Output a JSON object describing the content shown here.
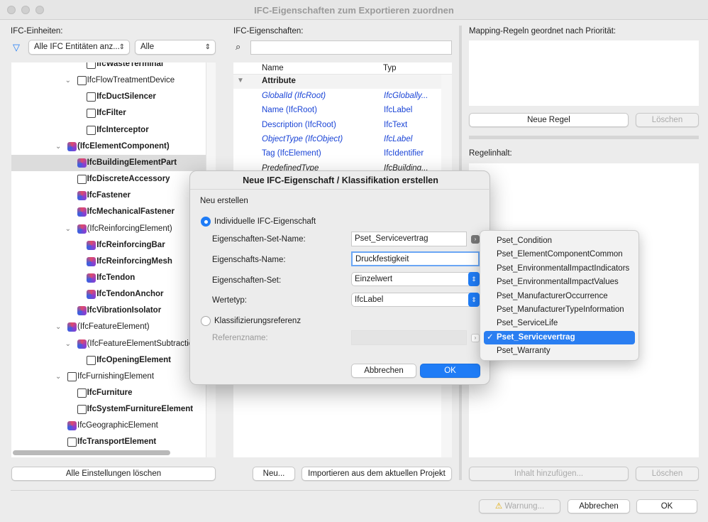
{
  "window": {
    "title": "IFC-Eigenschaften zum Exportieren zuordnen"
  },
  "left": {
    "label": "IFC-Einheiten:",
    "filter1": "Alle IFC Entitäten anz...",
    "filter2": "Alle",
    "clear_button": "Alle Einstellungen löschen",
    "tree": [
      {
        "label": "IfcWasteTerminal",
        "level": 2,
        "bold": true,
        "icon": "flow-terminal-icon",
        "expand": false
      },
      {
        "label": "IfcFlowTreatmentDevice",
        "level": 1,
        "bold": false,
        "icon": "treatment-device-icon",
        "expand": true
      },
      {
        "label": "IfcDuctSilencer",
        "level": 2,
        "bold": true,
        "icon": "treatment-device-icon",
        "expand": false
      },
      {
        "label": "IfcFilter",
        "level": 2,
        "bold": true,
        "icon": "treatment-device-icon",
        "expand": false
      },
      {
        "label": "IfcInterceptor",
        "level": 2,
        "bold": true,
        "icon": "treatment-device-icon",
        "expand": false
      },
      {
        "label": "(IfcElementComponent)",
        "level": 0,
        "bold": true,
        "icon": "ifc-icon",
        "expand": true
      },
      {
        "label": "IfcBuildingElementPart",
        "level": 1,
        "bold": true,
        "icon": "ifc-icon",
        "expand": false,
        "selected": true
      },
      {
        "label": "IfcDiscreteAccessory",
        "level": 1,
        "bold": true,
        "icon": "accessory-icon",
        "expand": false
      },
      {
        "label": "IfcFastener",
        "level": 1,
        "bold": true,
        "icon": "ifc-icon",
        "expand": false
      },
      {
        "label": "IfcMechanicalFastener",
        "level": 1,
        "bold": true,
        "icon": "ifc-icon",
        "expand": false
      },
      {
        "label": "(IfcReinforcingElement)",
        "level": 1,
        "bold": false,
        "icon": "ifc-icon",
        "expand": true
      },
      {
        "label": "IfcReinforcingBar",
        "level": 2,
        "bold": true,
        "icon": "ifc-icon",
        "expand": false
      },
      {
        "label": "IfcReinforcingMesh",
        "level": 2,
        "bold": true,
        "icon": "ifc-icon",
        "expand": false
      },
      {
        "label": "IfcTendon",
        "level": 2,
        "bold": true,
        "icon": "ifc-icon",
        "expand": false
      },
      {
        "label": "IfcTendonAnchor",
        "level": 2,
        "bold": true,
        "icon": "ifc-icon",
        "expand": false
      },
      {
        "label": "IfcVibrationIsolator",
        "level": 1,
        "bold": true,
        "icon": "ifc-icon",
        "expand": false
      },
      {
        "label": "(IfcFeatureElement)",
        "level": 0,
        "bold": false,
        "icon": "ifc-icon",
        "expand": true
      },
      {
        "label": "(IfcFeatureElementSubtraction)",
        "level": 1,
        "bold": false,
        "icon": "ifc-icon",
        "expand": true
      },
      {
        "label": "IfcOpeningElement",
        "level": 2,
        "bold": true,
        "icon": "opening-icon",
        "expand": false
      },
      {
        "label": "IfcFurnishingElement",
        "level": 0,
        "bold": false,
        "icon": "furniture-icon",
        "expand": true
      },
      {
        "label": "IfcFurniture",
        "level": 1,
        "bold": true,
        "icon": "furniture-icon",
        "expand": false
      },
      {
        "label": "IfcSystemFurnitureElement",
        "level": 1,
        "bold": true,
        "icon": "furniture-icon",
        "expand": false
      },
      {
        "label": "IfcGeographicElement",
        "level": 0,
        "bold": false,
        "icon": "ifc-icon",
        "expand": false
      },
      {
        "label": "IfcTransportElement",
        "level": 0,
        "bold": true,
        "icon": "transport-icon",
        "expand": false
      }
    ]
  },
  "middle": {
    "label": "IFC-Eigenschaften:",
    "search_placeholder": "",
    "col_name": "Name",
    "col_type": "Typ",
    "group": "Attribute",
    "rows": [
      {
        "name": "GlobalId (IfcRoot)",
        "type": "IfcGlobally...",
        "italic": true,
        "color": "#1a44d6"
      },
      {
        "name": "Name (IfcRoot)",
        "type": "IfcLabel",
        "italic": false,
        "color": "#1a44d6"
      },
      {
        "name": "Description (IfcRoot)",
        "type": "IfcText",
        "italic": false,
        "color": "#1a44d6"
      },
      {
        "name": "ObjectType (IfcObject)",
        "type": "IfcLabel",
        "italic": true,
        "color": "#1a44d6"
      },
      {
        "name": "Tag (IfcElement)",
        "type": "IfcIdentifier",
        "italic": false,
        "color": "#1a44d6"
      },
      {
        "name": "PredefinedType",
        "type": "IfcBuilding...",
        "italic": true,
        "color": "#222222"
      }
    ],
    "new_button": "Neu...",
    "import_button": "Importieren aus dem aktuellen Projekt"
  },
  "right": {
    "rules_label": "Mapping-Regeln geordnet nach Priorität:",
    "new_rule": "Neue Regel",
    "delete": "Löschen",
    "content_label": "Regelinhalt:",
    "add_content": "Inhalt hinzufügen...",
    "delete2": "Löschen"
  },
  "footer": {
    "warning": "Warnung...",
    "cancel": "Abbrechen",
    "ok": "OK"
  },
  "dialog": {
    "title": "Neue IFC-Eigenschaft / Klassifikation erstellen",
    "section": "Neu erstellen",
    "radio1": "Individuelle IFC-Eigenschaft",
    "radio2": "Klassifizierungsreferenz",
    "pset_name_label": "Eigenschaften-Set-Name:",
    "pset_name_value": "Pset_Servicevertrag",
    "prop_name_label": "Eigenschafts-Name:",
    "prop_name_value": "Druckfestigkeit",
    "pset_label": "Eigenschaften-Set:",
    "pset_value": "Einzelwert",
    "valuetype_label": "Wertetyp:",
    "valuetype_value": "IfcLabel",
    "ref_label": "Referenzname:",
    "ref_value": "",
    "cancel": "Abbrechen",
    "ok": "OK"
  },
  "popup": {
    "options": [
      "Pset_Condition",
      "Pset_ElementComponentCommon",
      "Pset_EnvironmentalImpactIndicators",
      "Pset_EnvironmentalImpactValues",
      "Pset_ManufacturerOccurrence",
      "Pset_ManufacturerTypeInformation",
      "Pset_ServiceLife",
      "Pset_Servicevertrag",
      "Pset_Warranty"
    ],
    "selected": "Pset_Servicevertrag",
    "check": "✓"
  }
}
